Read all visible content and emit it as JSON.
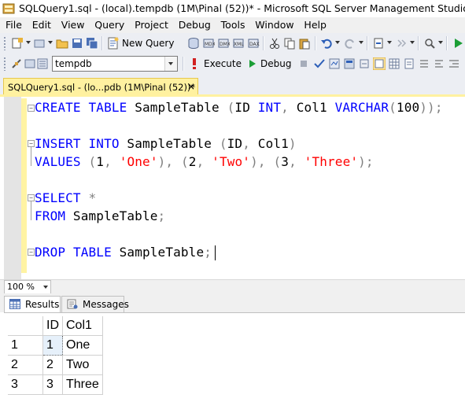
{
  "window": {
    "title": "SQLQuery1.sql - (local).tempdb (1M\\Pinal (52))* - Microsoft SQL Server Management Studio"
  },
  "menu": [
    "File",
    "Edit",
    "View",
    "Query",
    "Project",
    "Debug",
    "Tools",
    "Window",
    "Help"
  ],
  "toolbar": {
    "new_query_label": "New Query",
    "database": "tempdb",
    "execute_label": "Execute",
    "debug_label": "Debug"
  },
  "tab": {
    "label": "SQLQuery1.sql - (lo...pdb (1M\\Pinal (52))*",
    "close": "×"
  },
  "editor": {
    "lines": [
      {
        "tokens": [
          [
            "kw",
            "CREATE"
          ],
          [
            "plain",
            " "
          ],
          [
            "kw",
            "TABLE"
          ],
          [
            "plain",
            " SampleTable "
          ],
          [
            "gr",
            "("
          ],
          [
            "plain",
            "ID "
          ],
          [
            "kw",
            "INT"
          ],
          [
            "gr",
            ","
          ],
          [
            "plain",
            " Col1 "
          ],
          [
            "kw",
            "VARCHAR"
          ],
          [
            "gr",
            "("
          ],
          [
            "plain",
            "100"
          ],
          [
            "gr",
            "));"
          ]
        ]
      },
      {
        "tokens": [
          [
            "kw",
            "INSERT"
          ],
          [
            "plain",
            " "
          ],
          [
            "kw",
            "INTO"
          ],
          [
            "plain",
            " SampleTable "
          ],
          [
            "gr",
            "("
          ],
          [
            "plain",
            "ID"
          ],
          [
            "gr",
            ","
          ],
          [
            "plain",
            " Col1"
          ],
          [
            "gr",
            ")"
          ]
        ]
      },
      {
        "tokens": [
          [
            "kw",
            "VALUES"
          ],
          [
            "plain",
            " "
          ],
          [
            "gr",
            "("
          ],
          [
            "plain",
            "1"
          ],
          [
            "gr",
            ","
          ],
          [
            "plain",
            " "
          ],
          [
            "str",
            "'One'"
          ],
          [
            "gr",
            "),"
          ],
          [
            "plain",
            " "
          ],
          [
            "gr",
            "("
          ],
          [
            "plain",
            "2"
          ],
          [
            "gr",
            ","
          ],
          [
            "plain",
            " "
          ],
          [
            "str",
            "'Two'"
          ],
          [
            "gr",
            "),"
          ],
          [
            "plain",
            " "
          ],
          [
            "gr",
            "("
          ],
          [
            "plain",
            "3"
          ],
          [
            "gr",
            ","
          ],
          [
            "plain",
            " "
          ],
          [
            "str",
            "'Three'"
          ],
          [
            "gr",
            ");"
          ]
        ]
      },
      {
        "tokens": [
          [
            "kw",
            "SELECT"
          ],
          [
            "plain",
            " "
          ],
          [
            "gr",
            "*"
          ]
        ]
      },
      {
        "tokens": [
          [
            "kw",
            "FROM"
          ],
          [
            "plain",
            " SampleTable"
          ],
          [
            "gr",
            ";"
          ]
        ]
      },
      {
        "tokens": [
          [
            "kw",
            "DROP"
          ],
          [
            "plain",
            " "
          ],
          [
            "kw",
            "TABLE"
          ],
          [
            "plain",
            " SampleTable"
          ],
          [
            "gr",
            ";"
          ]
        ]
      }
    ]
  },
  "zoom": "100 %",
  "results_tabs": {
    "results": "Results",
    "messages": "Messages"
  },
  "grid": {
    "columns": [
      "ID",
      "Col1"
    ],
    "rows": [
      {
        "row_number": "1",
        "cells": [
          "1",
          "One"
        ]
      },
      {
        "row_number": "2",
        "cells": [
          "2",
          "Two"
        ]
      },
      {
        "row_number": "3",
        "cells": [
          "3",
          "Three"
        ]
      }
    ]
  },
  "colors": {
    "keyword": "#0000ff",
    "string": "#ff0000",
    "operator": "#808080",
    "active_tab": "#fff1a0"
  }
}
